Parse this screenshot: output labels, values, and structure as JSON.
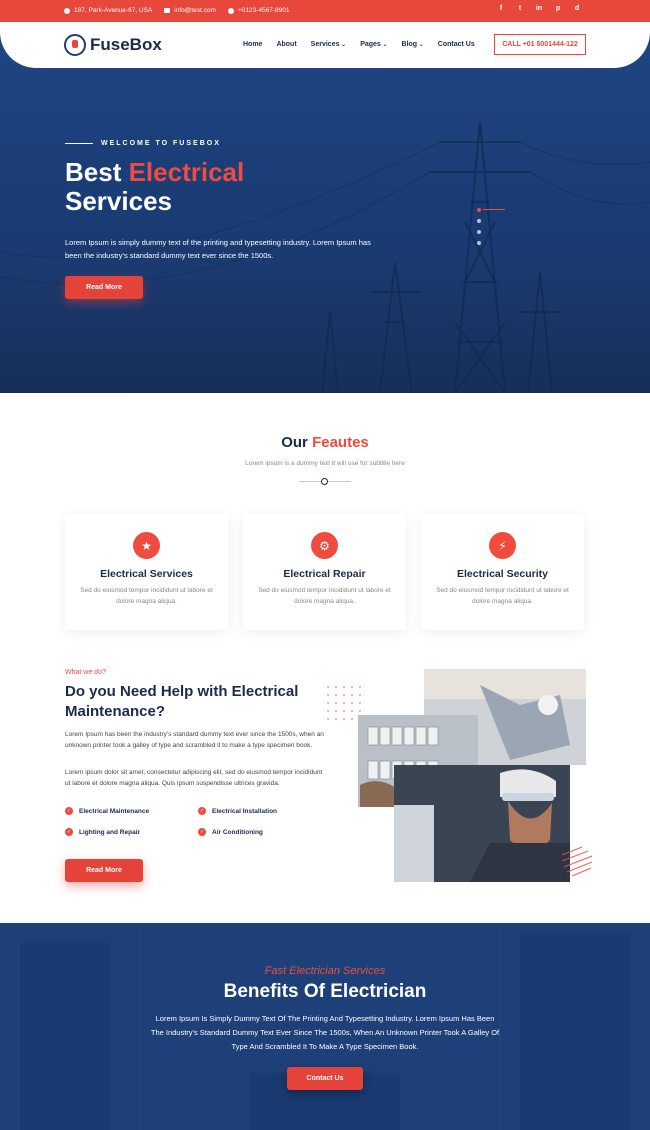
{
  "topbar": {
    "address": "187, Park-Avenue-67, USA",
    "email": "info@test.com",
    "phone": "+0123-4567-8901",
    "social": [
      "f",
      "t",
      "in",
      "p",
      "d"
    ]
  },
  "header": {
    "logo_text": "FuseBox",
    "nav": [
      {
        "label": "Home"
      },
      {
        "label": "About"
      },
      {
        "label": "Services"
      },
      {
        "label": "Pages"
      },
      {
        "label": "Blog"
      },
      {
        "label": "Contact Us"
      }
    ],
    "call_label": "CALL +01 5001444-122"
  },
  "hero": {
    "tag": "WELCOME TO FUSEBOX",
    "title_1": "Best ",
    "title_accent": "Electrical",
    "title_2": "Services",
    "text": "Lorem Ipsum is simply dummy text of the printing and typesetting industry. Lorem Ipsum has been the industry's standard dummy text ever since the 1500s.",
    "button": "Read More"
  },
  "features": {
    "title_1": "Our ",
    "title_accent": "Feautes",
    "subtitle": "Lorem ipsum is a dummy text it will use for subtitle here",
    "cards": [
      {
        "icon": "lightbulb-icon",
        "title": "Electrical Services",
        "text": "Sed do eiusmod tempor incididunt ut labore et dolore magna aliqua."
      },
      {
        "icon": "repair-icon",
        "title": "Electrical Repair",
        "text": "Sed do eiusmod tempor incididunt ut labore et dolore magna aliqua."
      },
      {
        "icon": "bolt-icon",
        "title": "Electrical Security",
        "text": "Sed do eiusmod tempor incididunt ut labore et dolore magna aliqua."
      }
    ]
  },
  "about": {
    "kicker": "What we do?",
    "title": "Do you Need Help with Electrical Maintenance?",
    "p1": "Lorem Ipsum has been the industry's standard dummy text ever since the 1500s, when an unknown printer took a galley of type and scrambled it to make a type specimen book.",
    "p2": "Lorem ipsum dolor sit amet, consectetur adipiscing elit, sed do eiusmod tempor incididunt ut labore et dolore magna aliqua. Quis ipsum suspendisse ultrices gravida.",
    "checks": [
      "Electrical Maintenance",
      "Electrical Installation",
      "Lighting and Repair",
      "Air Conditioning"
    ],
    "button": "Read More"
  },
  "benefits": {
    "subtitle": "Fast Electrician Services",
    "title": "Benefits Of Electrician",
    "text": "Lorem Ipsum Is Simply Dummy Text Of The Printing And Typesetting Industry. Lorem Ipsum Has Been The Industry's Standard Dummy Text Ever Since The 1500s, When An Unknown Printer Took A Galley Of Type And Scrambled It To Make A Type Specimen Book.",
    "button": "Contact Us"
  },
  "colors": {
    "accent": "#e8473b",
    "navy": "#1d4079",
    "text_dark": "#1b2a4e"
  }
}
